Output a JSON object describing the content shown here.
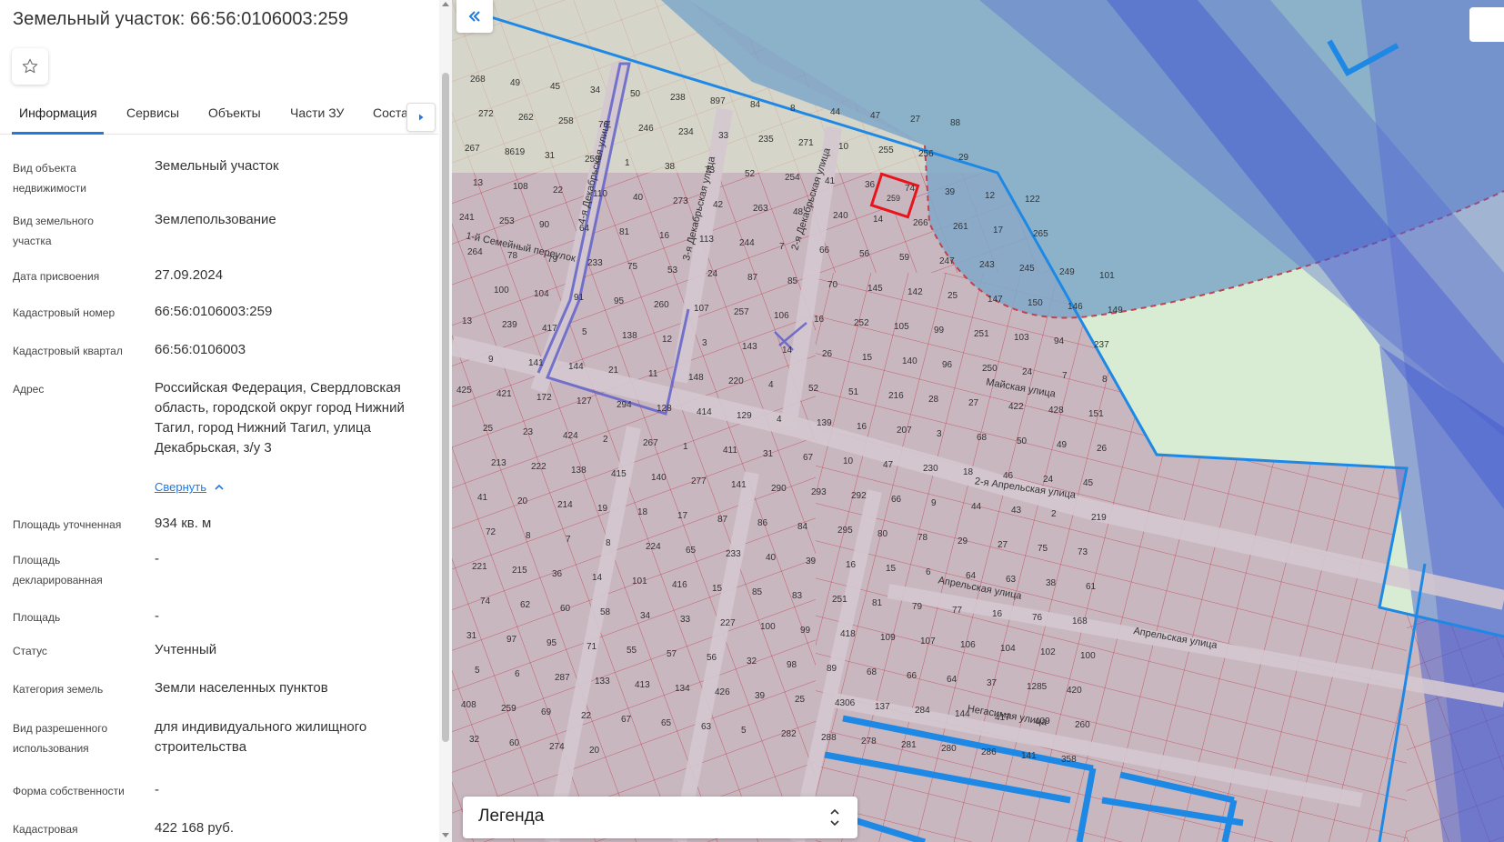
{
  "panel": {
    "title": "Земельный участок: 66:56:0106003:259",
    "tabs": [
      {
        "label": "Информация"
      },
      {
        "label": "Сервисы"
      },
      {
        "label": "Объекты"
      },
      {
        "label": "Части ЗУ"
      },
      {
        "label": "Соста"
      }
    ],
    "rows": [
      {
        "label": "Вид объекта недвижимости",
        "value": "Земельный участок"
      },
      {
        "label": "Вид земельного участка",
        "value": "Землепользование"
      },
      {
        "label": "Дата присвоения",
        "value": "27.09.2024"
      },
      {
        "label": "Кадастровый номер",
        "value": "66:56:0106003:259"
      },
      {
        "label": "Кадастровый квартал",
        "value": "66:56:0106003"
      },
      {
        "label": "Адрес",
        "value": "Российская Федерация, Свердловская область, городской округ город Нижний Тагил, город Нижний Тагил, улица Декабрьская, з/у 3"
      },
      {
        "label": "Площадь уточненная",
        "value": "934 кв. м"
      },
      {
        "label": "Площадь декларированная",
        "value": "-"
      },
      {
        "label": "Площадь",
        "value": "-"
      },
      {
        "label": "Статус",
        "value": "Учтенный"
      },
      {
        "label": "Категория земель",
        "value": "Земли населенных пунктов"
      },
      {
        "label": "Вид разрешенного использования",
        "value": "для индивидуального жилищного строительства"
      },
      {
        "label": "Форма собственности",
        "value": "-"
      },
      {
        "label": "Кадастровая",
        "value": "422 168 руб."
      }
    ],
    "collapse_link": "Свернуть"
  },
  "map": {
    "legend_label": "Легенда",
    "street_labels": [
      "4-я Декабрьская улица",
      "3-я Декабрьская улица",
      "2-я Декабрьская улица",
      "1-й Семейный переулок",
      "Майская улица",
      "2-я Апрельская улица",
      "Апрельская улица",
      "Апрельская улица",
      "Негасимая улица"
    ],
    "parcel_numbers": [
      "268",
      "49",
      "45",
      "34",
      "50",
      "238",
      "897",
      "84",
      "8",
      "44",
      "47",
      "27",
      "88",
      "272",
      "262",
      "258",
      "76",
      "246",
      "234",
      "33",
      "235",
      "271",
      "10",
      "255",
      "256",
      "29",
      "267",
      "8619",
      "31",
      "259",
      "1",
      "38",
      "73",
      "52",
      "254",
      "41",
      "36",
      "74",
      "39",
      "12",
      "122",
      "13",
      "108",
      "22",
      "110",
      "40",
      "273",
      "42",
      "263",
      "48",
      "240",
      "14",
      "266",
      "261",
      "17",
      "265",
      "241",
      "253",
      "90",
      "64",
      "81",
      "16",
      "113",
      "244",
      "7",
      "66",
      "56",
      "59",
      "247",
      "243",
      "245",
      "249",
      "101",
      "264",
      "78",
      "79",
      "233",
      "75",
      "53",
      "24",
      "87",
      "85",
      "70",
      "145",
      "142",
      "25",
      "147",
      "150",
      "146",
      "149",
      "100",
      "104",
      "91",
      "95",
      "260",
      "107",
      "257",
      "106",
      "16",
      "252",
      "105",
      "99",
      "251",
      "103",
      "94",
      "237",
      "13",
      "239",
      "417",
      "5",
      "138",
      "12",
      "3",
      "143",
      "14",
      "26",
      "15",
      "140",
      "96",
      "250",
      "24",
      "7",
      "8",
      "9",
      "141",
      "144",
      "21",
      "11",
      "148",
      "220",
      "4",
      "52",
      "51",
      "216",
      "28",
      "27",
      "422",
      "428",
      "151",
      "425",
      "421",
      "172",
      "127",
      "294",
      "128",
      "414",
      "129",
      "4",
      "139",
      "16",
      "207",
      "3",
      "68",
      "50",
      "49",
      "26",
      "25",
      "23",
      "424",
      "2",
      "267",
      "1",
      "411",
      "31",
      "67",
      "10",
      "47",
      "230",
      "18",
      "46",
      "24",
      "45",
      "213",
      "222",
      "138",
      "415",
      "140",
      "277",
      "141",
      "290",
      "293",
      "292",
      "66",
      "9",
      "44",
      "43",
      "2",
      "219",
      "41",
      "20",
      "214",
      "19",
      "18",
      "17",
      "87",
      "86",
      "84",
      "295",
      "80",
      "78",
      "29",
      "27",
      "75",
      "73",
      "72",
      "8",
      "7",
      "8",
      "224",
      "65",
      "233",
      "40",
      "39",
      "16",
      "15",
      "6",
      "64",
      "63",
      "38",
      "61",
      "221",
      "215",
      "36",
      "14",
      "101",
      "416",
      "15",
      "85",
      "83",
      "251",
      "81",
      "79",
      "77",
      "16",
      "76",
      "168",
      "74",
      "62",
      "60",
      "58",
      "34",
      "33",
      "227",
      "100",
      "99",
      "418",
      "109",
      "107",
      "106",
      "104",
      "102",
      "100",
      "31",
      "97",
      "95",
      "71",
      "55",
      "57",
      "56",
      "32",
      "98",
      "89",
      "68",
      "66",
      "64",
      "37",
      "1285",
      "420",
      "5",
      "6",
      "287",
      "133",
      "413",
      "134",
      "426",
      "39",
      "25",
      "4306",
      "137",
      "284",
      "144",
      "417",
      "409",
      "260",
      "408",
      "259",
      "69",
      "22",
      "67",
      "65",
      "63",
      "5",
      "282",
      "288",
      "278",
      "281",
      "280",
      "286",
      "141",
      "358",
      "32",
      "60",
      "274",
      "20"
    ],
    "colors": {
      "parcel_fill": "#c9b7c0",
      "parcel_border": "#c0424f",
      "selected_parcel": "#e8141c",
      "zone_blue": "#1e88e5",
      "water": "#7fa8c9",
      "green": "#d7ecd2",
      "road": "#d4c8cf",
      "overlay_dark_blue": "#4f63d1"
    }
  }
}
